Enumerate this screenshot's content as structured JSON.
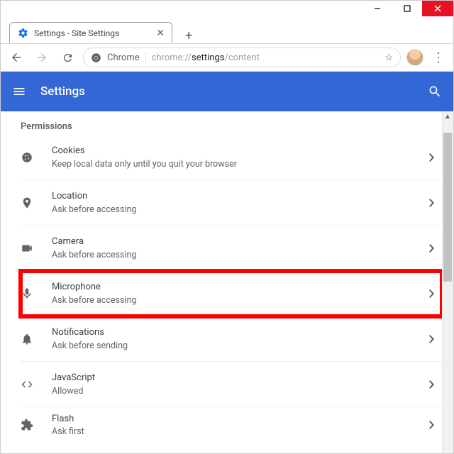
{
  "window": {
    "tab_title": "Settings - Site Settings"
  },
  "omnibox": {
    "scheme_label": "Chrome",
    "url_grey_prefix": "chrome://",
    "url_bold": "settings",
    "url_grey_suffix": "/content"
  },
  "header": {
    "title": "Settings"
  },
  "section": {
    "title": "Permissions"
  },
  "rows": [
    {
      "title": "Cookies",
      "sub": "Keep local data only until you quit your browser"
    },
    {
      "title": "Location",
      "sub": "Ask before accessing"
    },
    {
      "title": "Camera",
      "sub": "Ask before accessing"
    },
    {
      "title": "Microphone",
      "sub": "Ask before accessing"
    },
    {
      "title": "Notifications",
      "sub": "Ask before sending"
    },
    {
      "title": "JavaScript",
      "sub": "Allowed"
    },
    {
      "title": "Flash",
      "sub": "Ask first"
    }
  ]
}
